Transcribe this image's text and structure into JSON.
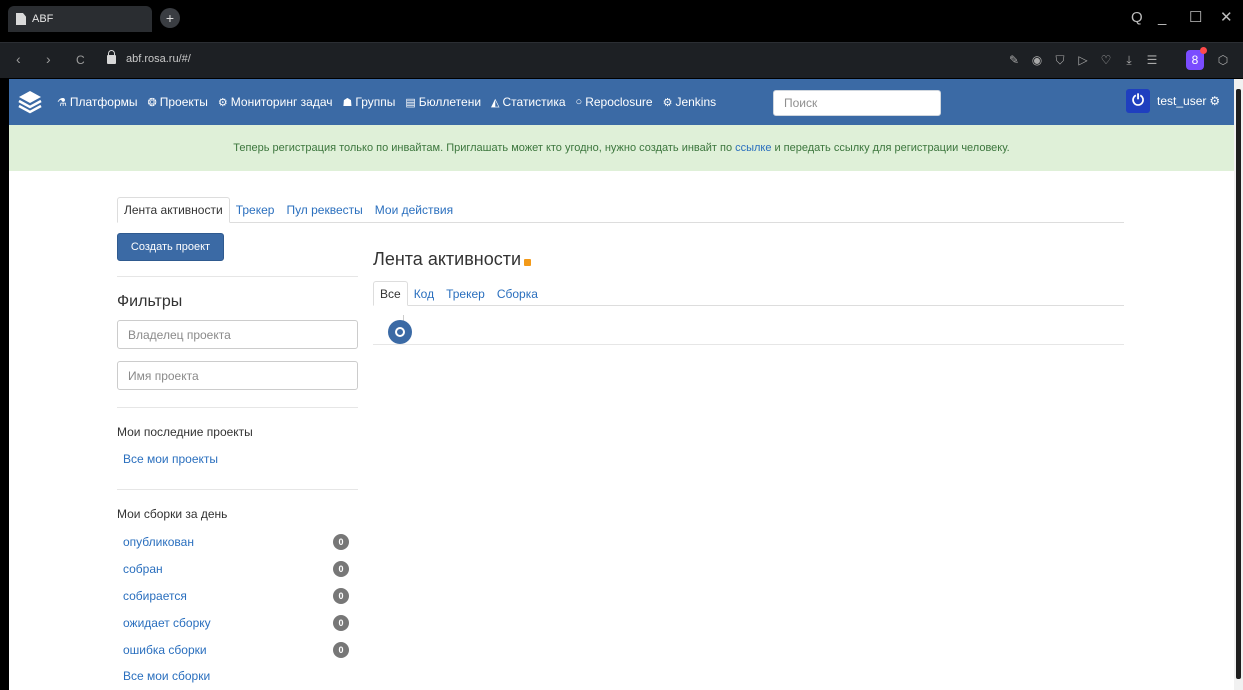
{
  "browser": {
    "tab_title": "ABF",
    "url": "abf.rosa.ru/#/",
    "new_tab": "+",
    "nav": {
      "back": "‹",
      "forward": "›",
      "reload": "C"
    },
    "window": {
      "search": "Q",
      "minimize": "_",
      "maximize": "☐",
      "close": "✕"
    },
    "profile_initial": "8"
  },
  "navbar": {
    "items": [
      {
        "label": "Платформы",
        "icon": "flask-icon",
        "glyph": "⚗"
      },
      {
        "label": "Проекты",
        "icon": "project-icon",
        "glyph": "❂"
      },
      {
        "label": "Мониторинг задач",
        "icon": "cogs-icon",
        "glyph": "⚙"
      },
      {
        "label": "Группы",
        "icon": "group-icon",
        "glyph": "☗"
      },
      {
        "label": "Бюллетени",
        "icon": "newspaper-icon",
        "glyph": "▤"
      },
      {
        "label": "Статистика",
        "icon": "chart-icon",
        "glyph": "◭"
      },
      {
        "label": "Repoclosure",
        "icon": "circle-icon",
        "glyph": "○"
      },
      {
        "label": "Jenkins",
        "icon": "cogs-icon",
        "glyph": "⚙"
      }
    ],
    "search_placeholder": "Поиск",
    "user": "test_user",
    "user_gear": "⚙",
    "power_glyph": "⏻"
  },
  "alert": {
    "before": "Теперь регистрация только по инвайтам. Приглашать может кто угодно, нужно создать инвайт по",
    "link": "ссылке",
    "after": "и передать ссылку для регистрации человеку."
  },
  "main_tabs": [
    "Лента активности",
    "Трекер",
    "Пул реквесты",
    "Мои действия"
  ],
  "create_button": "Создать проект",
  "filters": {
    "title": "Фильтры",
    "owner_placeholder": "Владелец проекта",
    "name_placeholder": "Имя проекта"
  },
  "recent_projects": {
    "title": "Мои последние проекты",
    "all_link": "Все мои проекты"
  },
  "builds": {
    "title": "Мои сборки за день",
    "items": [
      {
        "label": "опубликован",
        "count": "0"
      },
      {
        "label": "собран",
        "count": "0"
      },
      {
        "label": "собирается",
        "count": "0"
      },
      {
        "label": "ожидает сборку",
        "count": "0"
      },
      {
        "label": "ошибка сборки",
        "count": "0"
      }
    ],
    "all_link": "Все мои сборки"
  },
  "feed": {
    "title": "Лента активности",
    "tabs": [
      "Все",
      "Код",
      "Трекер",
      "Сборка"
    ]
  },
  "colors": {
    "navbar": "#3b6aa5",
    "alert_bg": "#dff0d8",
    "link": "#2a6fbe"
  }
}
